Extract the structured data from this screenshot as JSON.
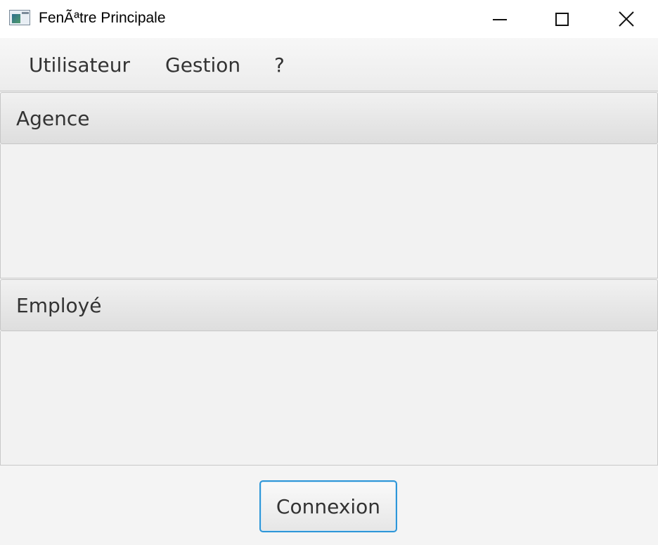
{
  "window": {
    "title": "FenÃªtre Principale"
  },
  "menubar": {
    "items": [
      {
        "label": "Utilisateur"
      },
      {
        "label": "Gestion"
      },
      {
        "label": "?"
      }
    ]
  },
  "panes": [
    {
      "title": "Agence"
    },
    {
      "title": "Employé"
    }
  ],
  "footer": {
    "connect_label": "Connexion"
  },
  "colors": {
    "focus_border": "#2d96d8",
    "background": "#f4f4f4"
  }
}
